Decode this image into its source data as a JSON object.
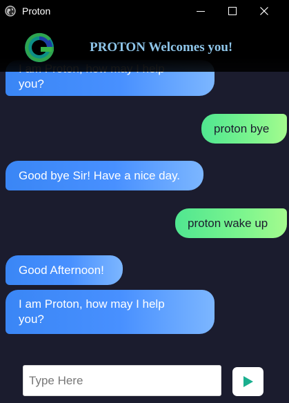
{
  "window": {
    "title": "Proton"
  },
  "header": {
    "title": "PROTON Welcomes you!"
  },
  "messages": [
    {
      "sender": "bot",
      "text_line1": "I am Proton, how may I help",
      "text_line2": "you?"
    },
    {
      "sender": "user",
      "text": "proton bye"
    },
    {
      "sender": "bot",
      "text": "Good bye Sir! Have a nice day."
    },
    {
      "sender": "user",
      "text": "proton wake up"
    },
    {
      "sender": "bot",
      "text": "Good Afternoon!"
    },
    {
      "sender": "bot",
      "text_line1": "I am Proton, how may I help",
      "text_line2": "you?"
    }
  ],
  "input": {
    "placeholder": "Type Here",
    "value": ""
  },
  "icons": {
    "app": "globe-icon",
    "send": "play-triangle-icon",
    "logo": "g-logo-icon"
  },
  "colors": {
    "background": "#1b1c2e",
    "bot_bubble": "#3a86f5",
    "user_bubble": "#6cf08e",
    "send_icon": "#1aaf8f",
    "header_text": "#8fc6ea"
  }
}
